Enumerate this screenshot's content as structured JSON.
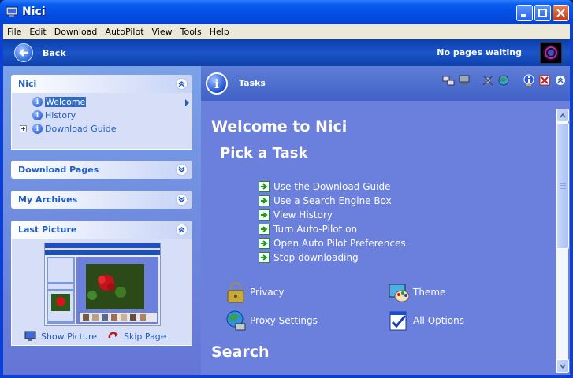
{
  "window": {
    "title": "Nici"
  },
  "menu": [
    "File",
    "Edit",
    "Download",
    "AutoPilot",
    "View",
    "Tools",
    "Help"
  ],
  "navbar": {
    "back_label": "Back",
    "status": "No pages waiting"
  },
  "left": {
    "nici_panel": {
      "title": "Nici",
      "items": [
        {
          "label": "Welcome"
        },
        {
          "label": "History"
        },
        {
          "label": "Download Guide"
        }
      ]
    },
    "download_pages": {
      "title": "Download Pages"
    },
    "my_archives": {
      "title": "My Archives"
    },
    "last_picture": {
      "title": "Last Picture",
      "show_picture": "Show Picture",
      "skip_page": "Skip Page"
    }
  },
  "right": {
    "tasks_label": "Tasks",
    "welcome_heading": "Welcome to Nici",
    "pick_heading": "Pick a Task",
    "tasks": [
      "Use the Download Guide",
      "Use a Search Engine Box",
      "View History",
      "Turn Auto-Pilot on",
      "Open Auto Pilot Preferences",
      "Stop downloading"
    ],
    "options": {
      "privacy": "Privacy",
      "theme": "Theme",
      "proxy": "Proxy Settings",
      "all_options": "All Options"
    },
    "search_heading": "Search"
  },
  "colors": {
    "accent": "#215dc6",
    "task_pane": "#6b7fdc",
    "title_bar": "#0550e6"
  }
}
